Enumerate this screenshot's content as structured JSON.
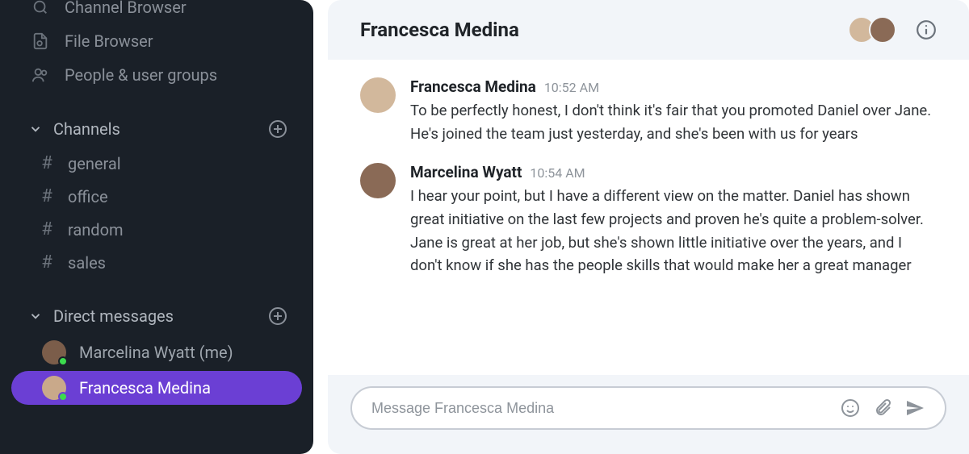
{
  "sidebar": {
    "top_nav": [
      {
        "label": "Channel Browser",
        "icon": "search-hash-icon"
      },
      {
        "label": "File Browser",
        "icon": "file-icon"
      },
      {
        "label": "People & user groups",
        "icon": "people-icon"
      }
    ],
    "channels_section_label": "Channels",
    "channels": [
      "general",
      "office",
      "random",
      "sales"
    ],
    "dm_section_label": "Direct messages",
    "dms": [
      {
        "label": "Marcelina Wyatt (me)",
        "active": false
      },
      {
        "label": "Francesca Medina",
        "active": true
      }
    ]
  },
  "header": {
    "title": "Francesca Medina"
  },
  "messages": [
    {
      "author": "Francesca Medina",
      "time": "10:52 AM",
      "text": "To be perfectly honest, I don't think it's fair that you promoted Daniel over Jane. He's joined the team just yesterday, and she's been with us for years"
    },
    {
      "author": "Marcelina Wyatt",
      "time": "10:54 AM",
      "text": "I hear your point, but I have a different view on the matter. Daniel has shown great initiative on the last few projects and proven he's quite a problem-solver. Jane is great at her job, but she's shown little initiative over the years, and I don't know if she has the people skills that would make her a great manager"
    }
  ],
  "composer": {
    "placeholder": "Message Francesca Medina"
  }
}
